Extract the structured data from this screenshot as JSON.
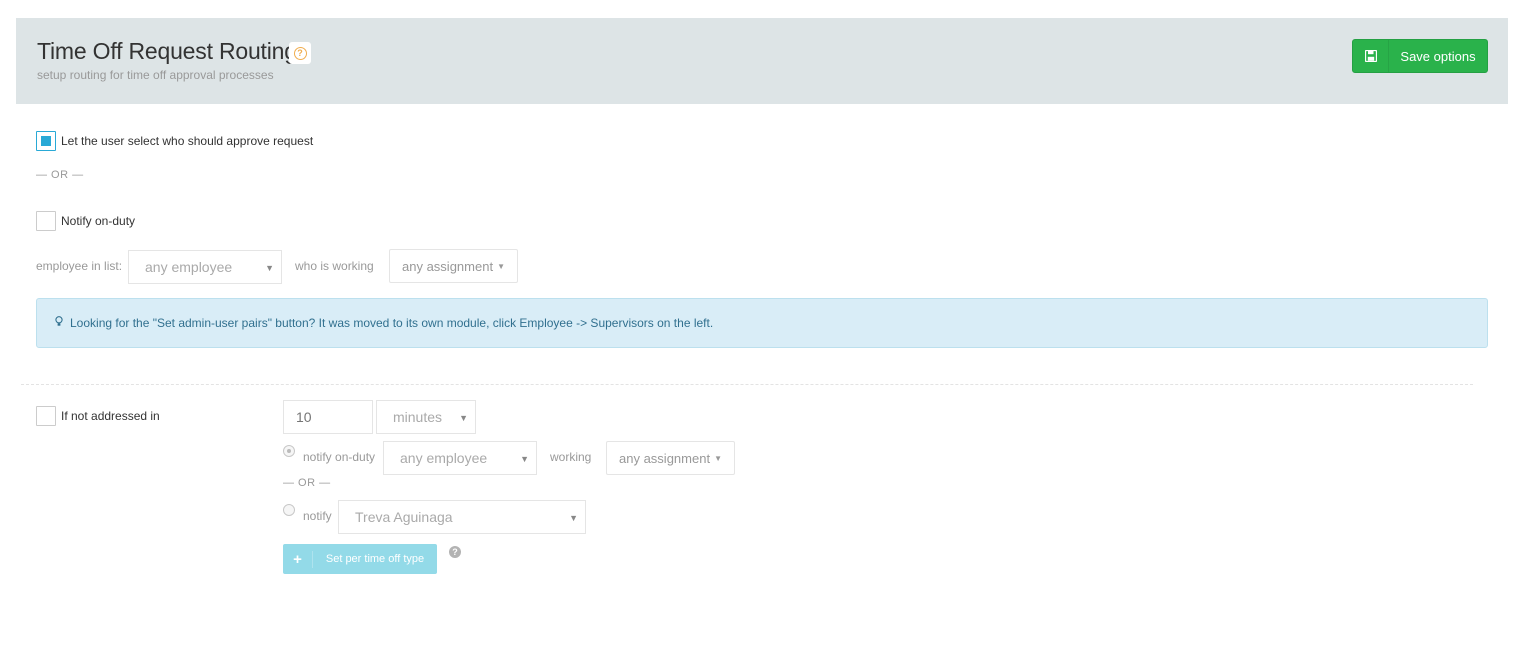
{
  "header": {
    "title": "Time Off Request Routing",
    "help_glyph": "?",
    "subtitle": "setup routing for time off approval processes",
    "save_label": "Save options"
  },
  "option_user_select": {
    "label": "Let the user select who should approve request",
    "checked": true
  },
  "or_separator": "— OR —",
  "option_notify_on_duty": {
    "label": "Notify on-duty",
    "checked": false,
    "employee_in_list_label": "employee in list:",
    "employee_select_value": "any employee",
    "who_is_working_label": "who is working",
    "assignment_value": "any assignment"
  },
  "alert": {
    "text": "Looking for the \"Set admin-user pairs\" button? It was moved to its own module, click Employee -> Supervisors on the left."
  },
  "escalation": {
    "label": "If not addressed in",
    "checked": false,
    "amount_placeholder": "10",
    "unit_value": "minutes",
    "notify_on_duty_label": "notify on-duty",
    "employee_select_value": "any employee",
    "working_label": "working",
    "assignment_value": "any assignment",
    "or_separator": "— OR —",
    "notify_label": "notify",
    "person_value": "Treva Aguinaga",
    "per_type_label": "Set per time off type",
    "plus_glyph": "+",
    "help_glyph": "?"
  },
  "colors": {
    "header_bg": "#dde4e6",
    "save_green": "#2ab24b",
    "check_blue": "#29a9d6",
    "alert_bg": "#d9edf7",
    "per_type_bg": "#93dae8"
  }
}
